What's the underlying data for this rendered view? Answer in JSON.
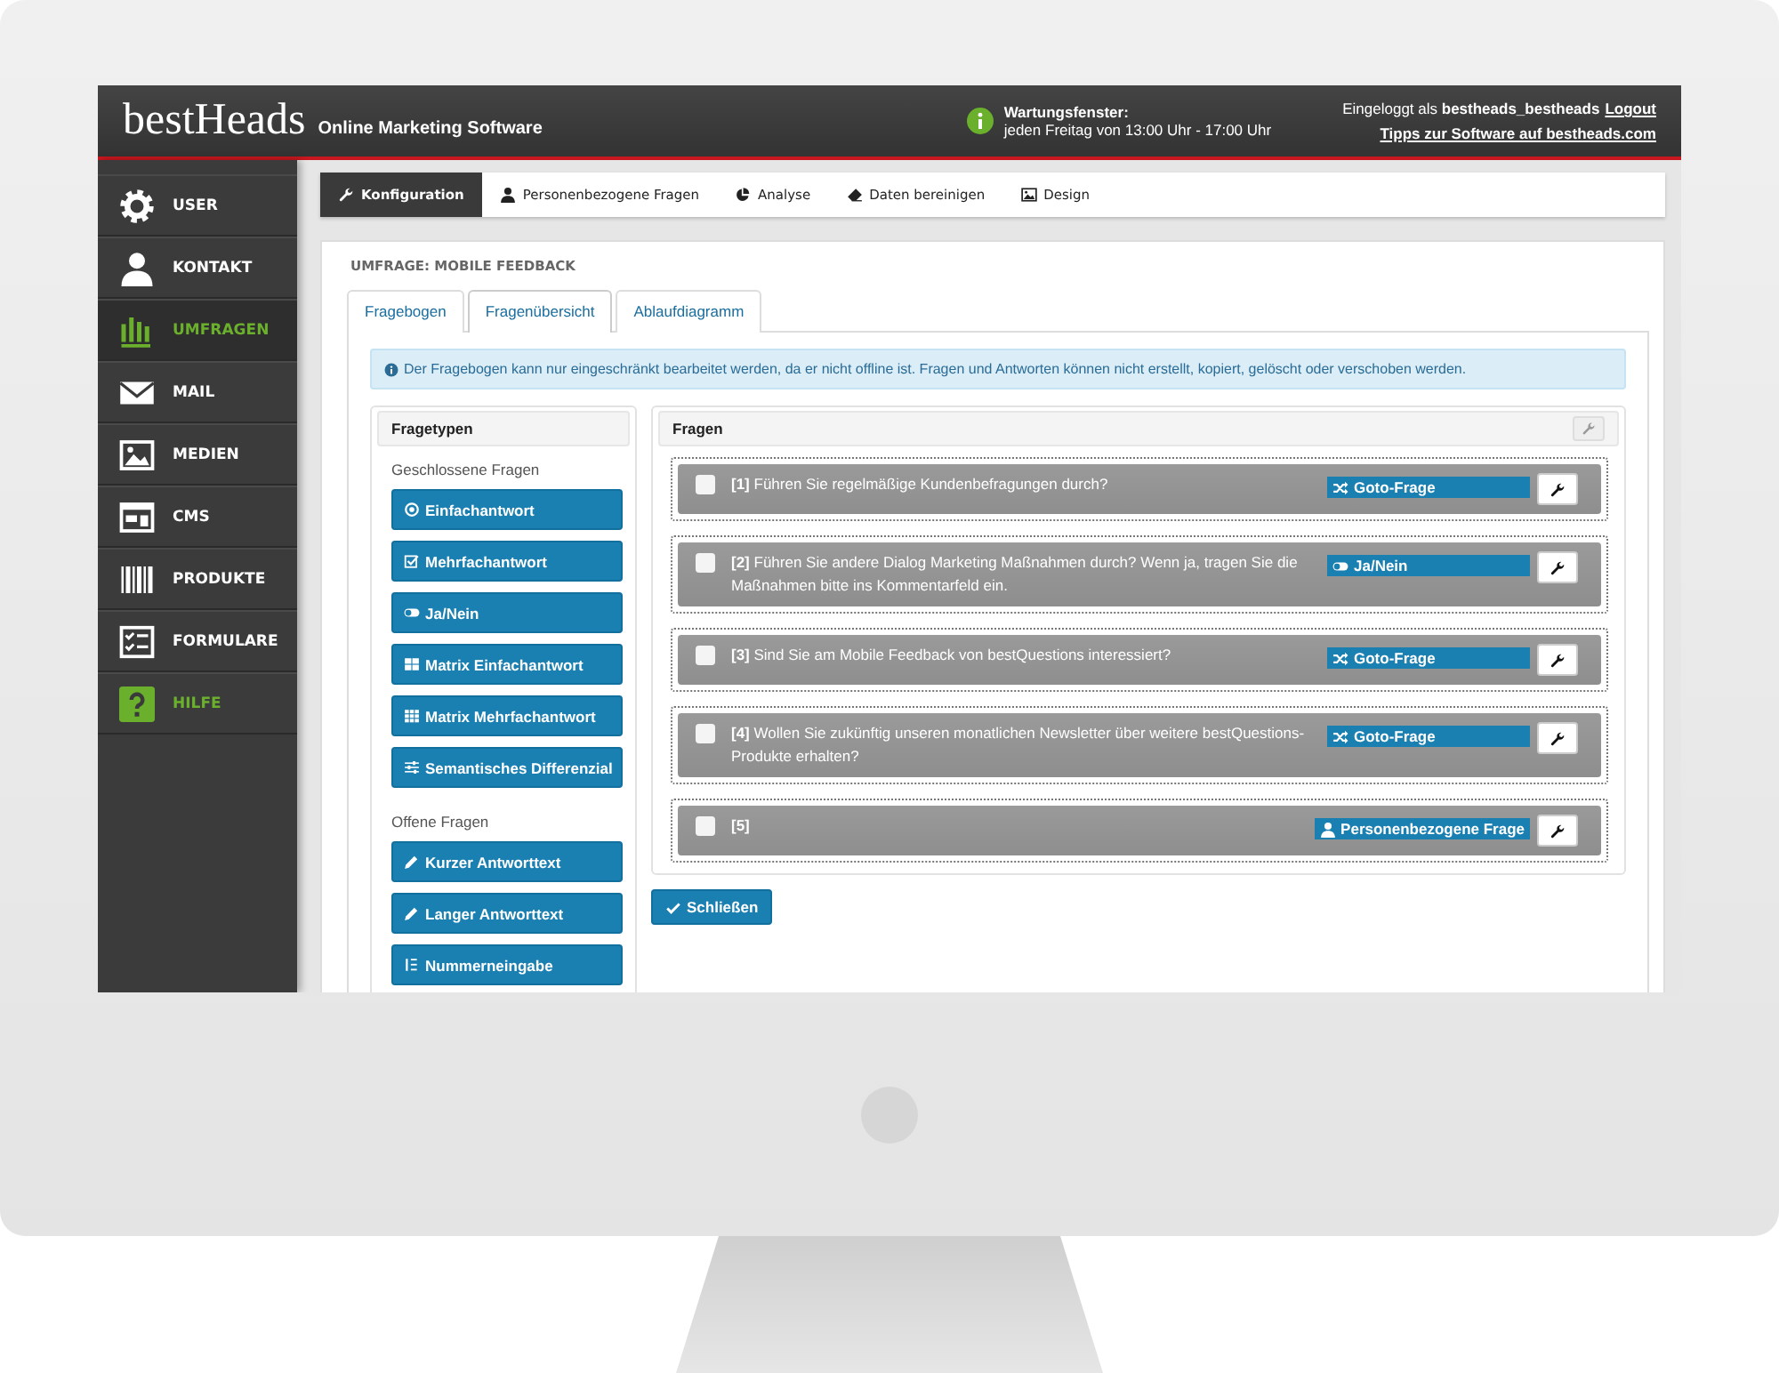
{
  "header": {
    "logo": "bestHeads",
    "tagline": "Online Marketing Software",
    "notice_title": "Wartungsfenster:",
    "notice_text": "jeden Freitag von 13:00 Uhr - 17:00 Uhr",
    "login_text": "Eingeloggt als **bestheads_bestheads**",
    "logout_link": "Logout",
    "tips_link": "Tipps zur Software auf bestheads.com"
  },
  "sidebar": {
    "items": [
      {
        "label": "USER",
        "selected": false,
        "kind": "nav"
      },
      {
        "label": "KONTAKT",
        "selected": false,
        "kind": "nav"
      },
      {
        "label": "UMFRAGEN",
        "selected": true,
        "kind": "nav"
      },
      {
        "label": "MAIL",
        "selected": false,
        "kind": "nav"
      },
      {
        "label": "MEDIEN",
        "selected": false,
        "kind": "nav"
      },
      {
        "label": "CMS",
        "selected": false,
        "kind": "nav"
      },
      {
        "label": "PRODUKTE",
        "selected": false,
        "kind": "nav"
      },
      {
        "label": "FORMULARE",
        "selected": false,
        "kind": "nav"
      },
      {
        "label": "HILFE",
        "selected": false,
        "kind": "help"
      }
    ]
  },
  "top_tabs": [
    {
      "label": "Konfiguration",
      "selected": true
    },
    {
      "label": "Personenbezogene Fragen",
      "selected": false
    },
    {
      "label": "Analyse",
      "selected": false
    },
    {
      "label": "Daten bereinigen",
      "selected": false
    },
    {
      "label": "Design",
      "selected": false
    }
  ],
  "panel": {
    "title": "UMFRAGE: MOBILE FEEDBACK",
    "tabs": [
      {
        "label": "Fragebogen",
        "selected": false
      },
      {
        "label": "Fragenübersicht",
        "selected": true
      },
      {
        "label": "Ablaufdiagramm",
        "selected": false
      }
    ],
    "alert": "Der Fragebogen kann nur eingeschränkt bearbeitet werden, da er nicht offline ist. Fragen und Antworten können nicht erstellt, kopiert, gelöscht oder verschoben werden.",
    "question_types": {
      "title": "Fragetypen",
      "groups": [
        {
          "heading": "Geschlossene Fragen",
          "buttons": [
            "Einfachantwort",
            "Mehrfachantwort",
            "Ja/Nein",
            "Matrix Einfachantwort",
            "Matrix Mehrfachantwort",
            "Semantisches Differenzial"
          ]
        },
        {
          "heading": "Offene Fragen",
          "buttons": [
            "Kurzer Antworttext",
            "Langer Antworttext",
            "Nummerneingabe"
          ]
        }
      ]
    },
    "questions": {
      "title": "Fragen",
      "items": [
        {
          "text": "**[1]** Führen Sie regelmäßige Kundenbefragungen durch?",
          "checked": false,
          "type": "Goto-Frage",
          "kind": "goto"
        },
        {
          "text": "**[2]** Führen Sie andere Dialog Marketing Maßnahmen durch? Wenn ja, tragen Sie die Maßnahmen bitte ins Kommentarfeld ein.",
          "checked": false,
          "type": "Ja/Nein",
          "kind": "yesno"
        },
        {
          "text": "**[3]** Sind Sie am Mobile Feedback von bestQuestions interessiert?",
          "checked": false,
          "type": "Goto-Frage",
          "kind": "goto"
        },
        {
          "text": "**[4]** Wollen Sie zukünftig unseren monatlichen Newsletter über weitere bestQuestions-Produkte erhalten?",
          "checked": false,
          "type": "Goto-Frage",
          "kind": "goto"
        },
        {
          "text": "**[5]**",
          "checked": false,
          "type": "Personenbezogene Frage",
          "kind": "person"
        }
      ]
    },
    "close_button": "Schließen"
  }
}
